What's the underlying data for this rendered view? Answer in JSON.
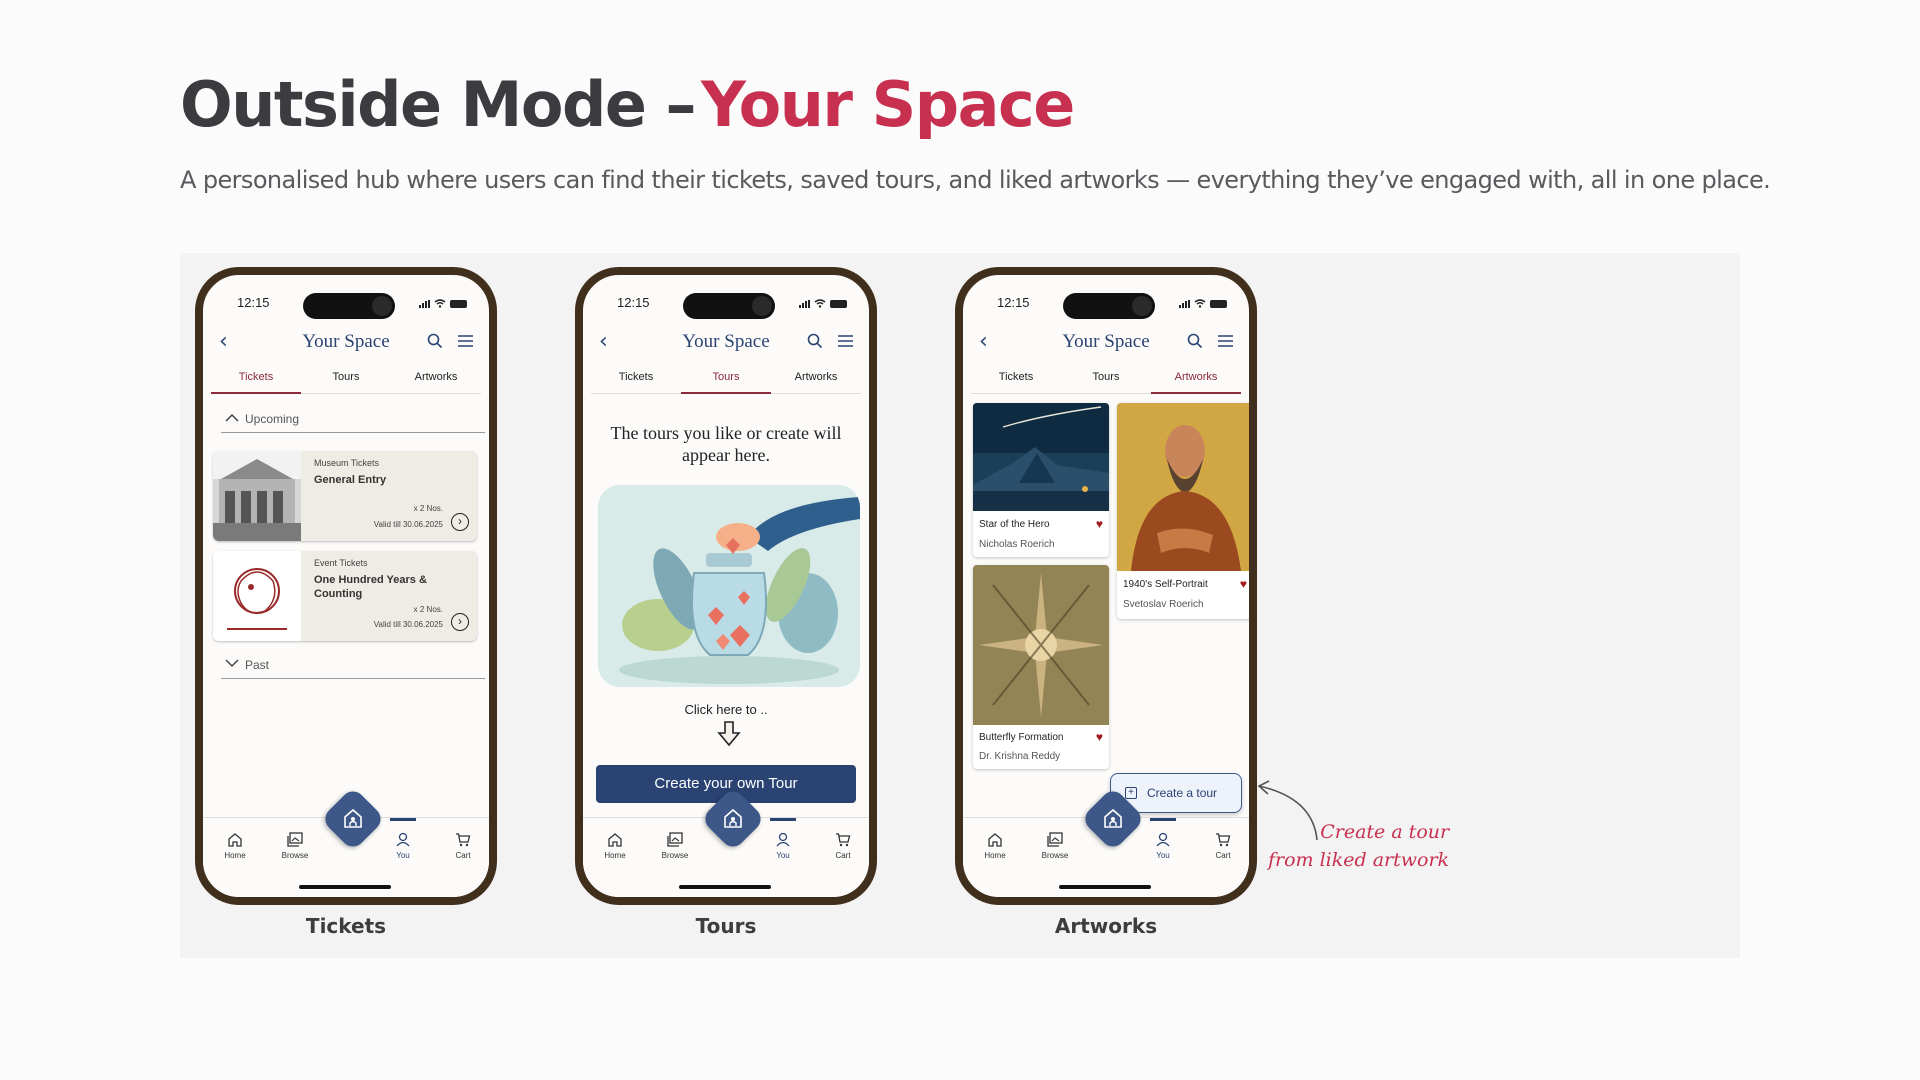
{
  "header": {
    "title": "Outside Mode –",
    "title_accent": "Your Space",
    "subtitle": "A personalised hub where users can find their tickets, saved tours, and liked artworks — everything they’ve engaged with, all in one place."
  },
  "colors": {
    "accent": "#c83050",
    "navy": "#2a4372",
    "phone_frame": "#3f2f1c",
    "tab_active": "#8a2a3c",
    "heart": "#a1181e"
  },
  "status_bar": {
    "time": "12:15"
  },
  "app_bar": {
    "title": "Your Space",
    "back_icon": "chevron-left-icon",
    "search_icon": "search-icon",
    "menu_icon": "menu-icon"
  },
  "tabs": [
    "Tickets",
    "Tours",
    "Artworks"
  ],
  "nav": {
    "home": "Home",
    "browse": "Browse",
    "you": "You",
    "cart": "Cart"
  },
  "screens": {
    "tickets": {
      "caption": "Tickets",
      "active_tab": "Tickets",
      "upcoming_label": "Upcoming",
      "past_label": "Past",
      "tickets": [
        {
          "kind": "Museum Tickets",
          "name": "General Entry",
          "qty": "x 2 Nos.",
          "valid": "Valid till 30.06.2025"
        },
        {
          "kind": "Event Tickets",
          "name": "One Hundred Years & Counting",
          "qty": "x 2 Nos.",
          "valid": "Valid till 30.06.2025"
        }
      ]
    },
    "tours": {
      "caption": "Tours",
      "active_tab": "Tours",
      "empty_text": "The tours you like or create will appear here.",
      "click_text": "Click here to ..",
      "cta_label": "Create your own Tour"
    },
    "artworks": {
      "caption": "Artworks",
      "active_tab": "Artworks",
      "artworks": [
        {
          "title": "Star of the Hero",
          "artist": "Nicholas Roerich",
          "liked": true
        },
        {
          "title": "1940's Self-Portrait",
          "artist": "Svetoslav Roerich",
          "liked": true
        },
        {
          "title": "Butterfly Formation",
          "artist": "Dr. Krishna Reddy",
          "liked": true
        }
      ],
      "create_tour_label": "Create a tour"
    }
  },
  "annotation": {
    "line1": "Create a tour",
    "line2": "from liked artwork"
  }
}
